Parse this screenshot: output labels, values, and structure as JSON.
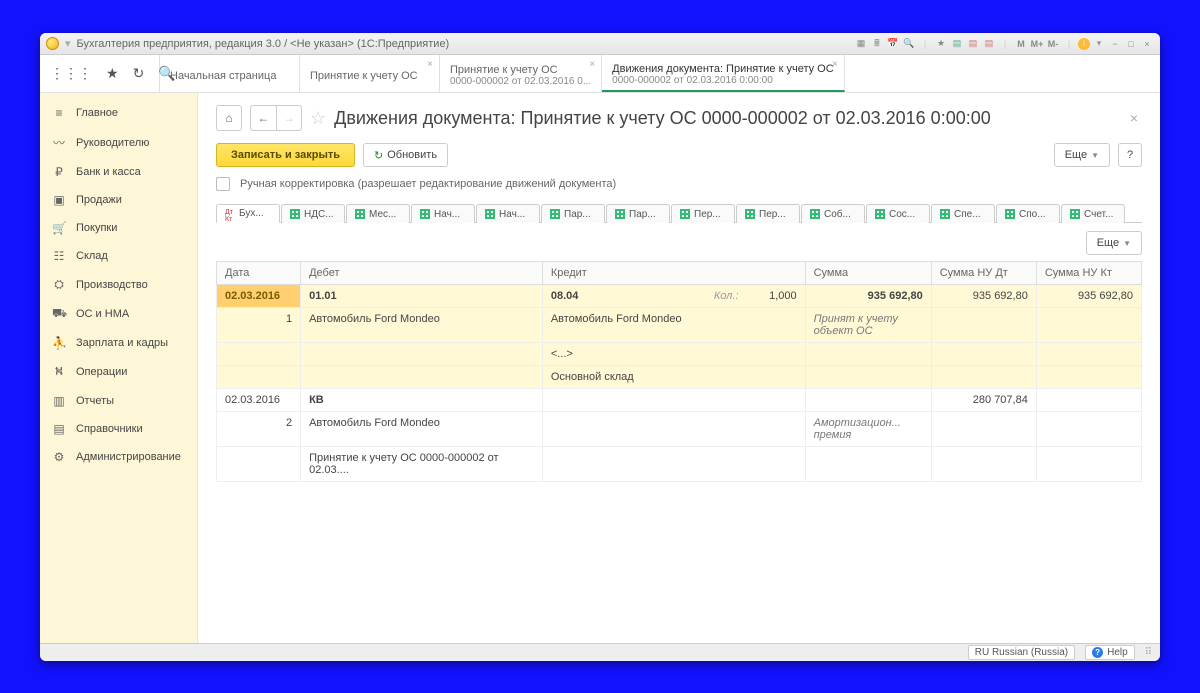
{
  "titlebar": {
    "title": "Бухгалтерия предприятия, редакция 3.0 / <Не указан>   (1С:Предприятие)",
    "m_buttons": [
      "M",
      "M+",
      "M-"
    ]
  },
  "app_tabs": [
    {
      "line1": "Начальная страница",
      "line2": ""
    },
    {
      "line1": "Принятие к учету ОС",
      "line2": ""
    },
    {
      "line1": "Принятие к учету ОС",
      "line2": "0000-000002 от 02.03.2016 0..."
    },
    {
      "line1": "Движения документа: Принятие к учету ОС",
      "line2": "0000-000002 от 02.03.2016 0:00:00"
    }
  ],
  "sidebar": [
    "Главное",
    "Руководителю",
    "Банк и касса",
    "Продажи",
    "Покупки",
    "Склад",
    "Производство",
    "ОС и НМА",
    "Зарплата и кадры",
    "Операции",
    "Отчеты",
    "Справочники",
    "Администрирование"
  ],
  "sidebar_icons": [
    "≡",
    "〰",
    "₽",
    "▣",
    "🛒",
    "☷",
    "⛭",
    "⛟",
    "⛹",
    "⛕",
    "▥",
    "▤",
    "⚙"
  ],
  "page": {
    "title": "Движения документа: Принятие к учету ОС 0000-000002 от 02.03.2016 0:00:00",
    "save_close": "Записать и закрыть",
    "refresh": "Обновить",
    "more": "Еще",
    "manual_correction": "Ручная корректировка (разрешает редактирование движений документа)"
  },
  "subtabs": [
    "Бух...",
    "НДС...",
    "Мес...",
    "Нач...",
    "Нач...",
    "Пар...",
    "Пар...",
    "Пер...",
    "Пер...",
    "Соб...",
    "Сос...",
    "Спе...",
    "Спо...",
    "Счет..."
  ],
  "table": {
    "headers": [
      "Дата",
      "Дебет",
      "Кредит",
      "Сумма",
      "Сумма НУ Дт",
      "Сумма НУ Кт"
    ],
    "group1": {
      "date": "02.03.2016",
      "num": "1",
      "debet_acc": "01.01",
      "debet_desc": "Автомобиль Ford Mondeo",
      "kredit_acc": "08.04",
      "kredit_qty_label": "Кол.:",
      "kredit_qty": "1,000",
      "kredit_desc": "Автомобиль Ford Mondeo",
      "kredit_sub1": "<...>",
      "kredit_sub2": "Основной склад",
      "sum": "935 692,80",
      "sum_desc": "Принят к учету объект ОС",
      "sum_dt": "935 692,80",
      "sum_kt": "935 692,80"
    },
    "group2": {
      "date": "02.03.2016",
      "num": "2",
      "debet_acc": "КВ",
      "debet_desc": "Автомобиль Ford Mondeo",
      "debet_sub": "Принятие к учету ОС 0000-000002 от 02.03....",
      "sum_desc": "Амортизацион... премия",
      "sum_dt": "280 707,84"
    }
  },
  "statusbar": {
    "lang": "RU Russian (Russia)",
    "help": "Help"
  }
}
